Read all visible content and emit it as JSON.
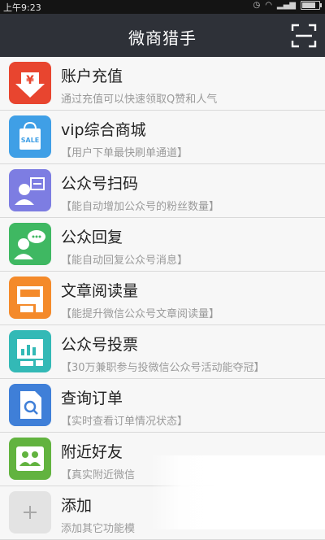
{
  "status_bar": {
    "time": "上午9:23"
  },
  "header": {
    "title": "微商猎手"
  },
  "colors": {
    "header_bg": "#2e3138",
    "recharge": "#e8452f",
    "mall": "#3f9fe6",
    "scan": "#7d7de2",
    "reply": "#3fb862",
    "reading": "#f48a2a",
    "vote": "#33b9b6",
    "order": "#3f7fd8",
    "nearby": "#62b33f",
    "add": "#e3e3e3"
  },
  "items": [
    {
      "label": "账户充值",
      "desc": "通过充值可以快速领取Q赞和人气",
      "icon": "recharge-icon"
    },
    {
      "label": "vip综合商城",
      "desc": "【用户下单最快刷单通道】",
      "icon": "sale-bag-icon"
    },
    {
      "label": "公众号扫码",
      "desc": "【能自动增加公众号的粉丝数量】",
      "icon": "scan-user-icon"
    },
    {
      "label": "公众回复",
      "desc": "【能自动回复公众号消息】",
      "icon": "reply-chat-icon"
    },
    {
      "label": "文章阅读量",
      "desc": "【能提升微信公众号文章阅读量】",
      "icon": "article-icon"
    },
    {
      "label": "公众号投票",
      "desc": "【30万兼职参与投微信公众号活动能夺冠】",
      "icon": "vote-chart-icon"
    },
    {
      "label": "查询订单",
      "desc": "【实时查看订单情况状态】",
      "icon": "order-search-icon"
    },
    {
      "label": "附近好友",
      "desc": "【真实附近微信",
      "icon": "nearby-friends-icon"
    },
    {
      "label": "添加",
      "desc": "添加其它功能模",
      "icon": "plus-icon"
    }
  ],
  "sale_text": "SALE"
}
